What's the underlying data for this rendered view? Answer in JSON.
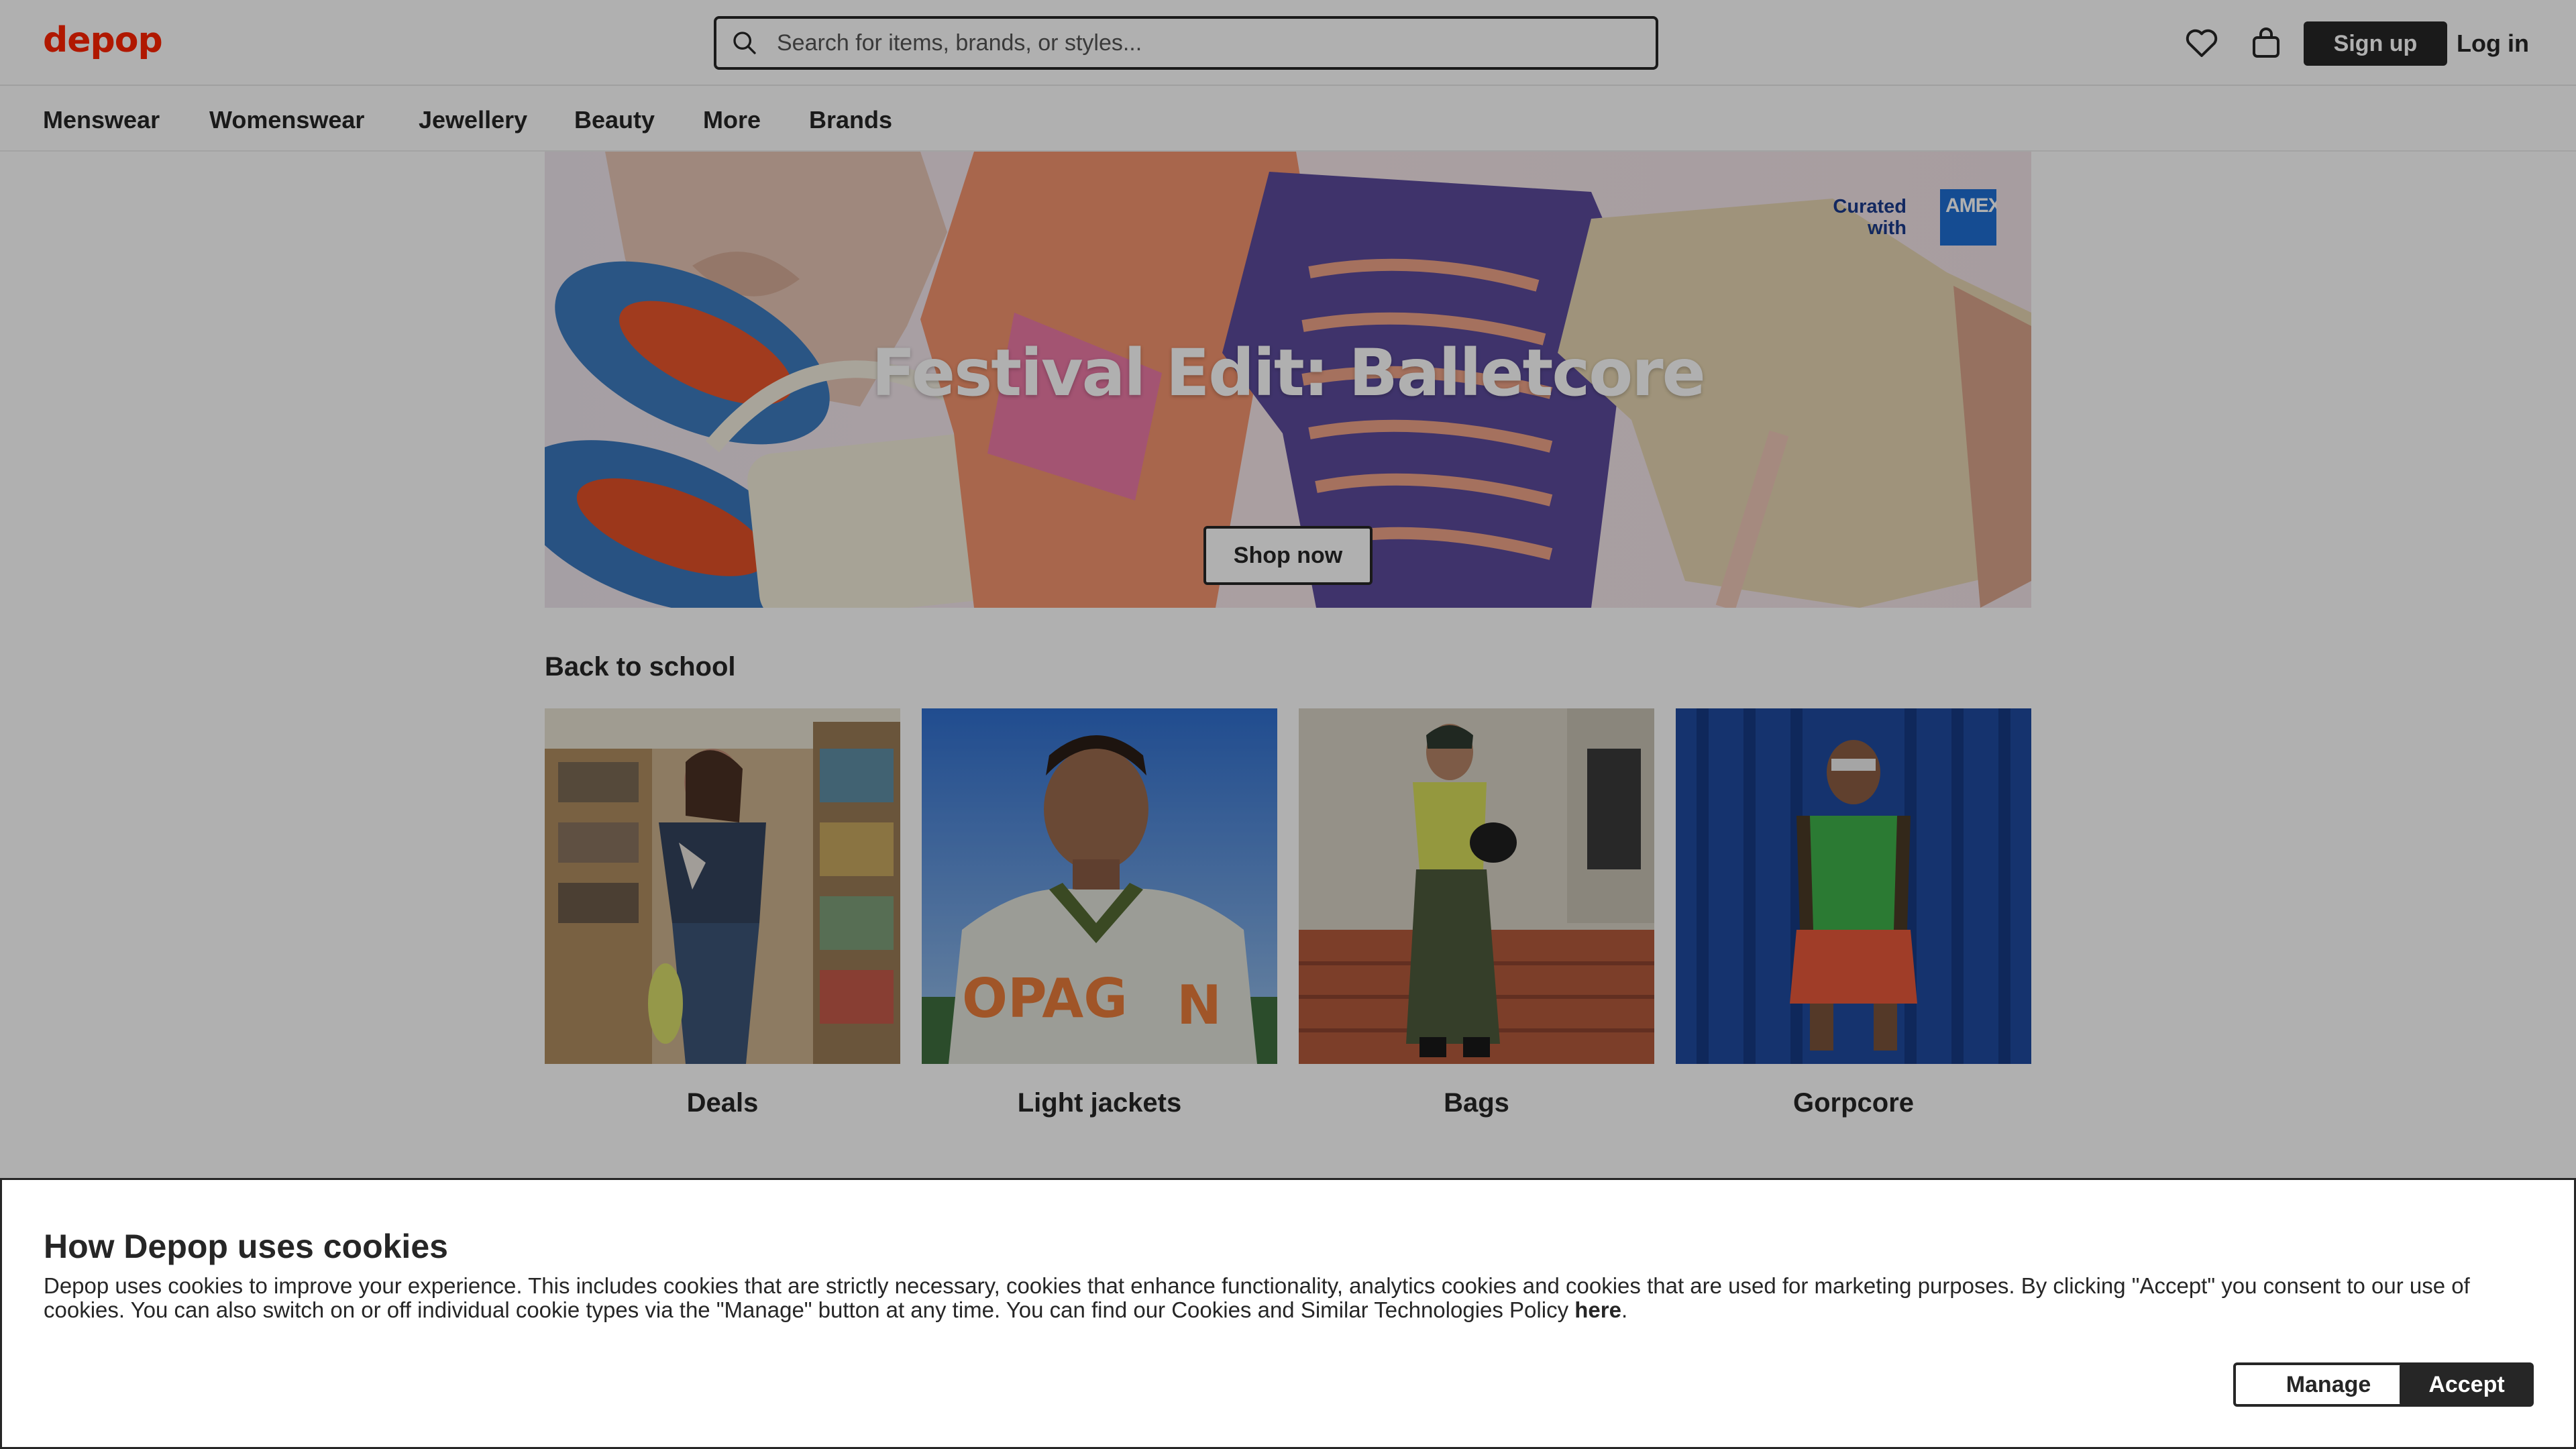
{
  "header": {
    "logo": "depop",
    "search_placeholder": "Search for items, brands, or styles...",
    "signup_label": "Sign up",
    "login_label": "Log in",
    "icons": [
      "search-icon",
      "heart-icon",
      "bag-icon"
    ]
  },
  "nav": {
    "items": [
      "Menswear",
      "Womenswear",
      "Jewellery",
      "Beauty",
      "More",
      "Brands"
    ]
  },
  "hero": {
    "title": "Festival Edit: Balletcore",
    "button": "Shop now",
    "curated_line1": "Curated",
    "curated_line2": "with",
    "partner_logo_text": "AMEX"
  },
  "section": {
    "title": "Back to school",
    "tiles": [
      "Deals",
      "Light jackets",
      "Bags",
      "Gorpcore"
    ]
  },
  "cookies": {
    "title": "How Depop uses cookies",
    "body": "Depop uses cookies to improve your experience. This includes cookies that are strictly necessary, cookies that enhance functionality, analytics cookies and cookies that are used for marketing purposes. By clicking \"Accept\" you consent to our use of cookies. You can also switch on or off individual cookie types via the \"Manage\" button at any time. You can find our Cookies and Similar Technologies Policy",
    "link": "here",
    "manage_label": "Manage",
    "accept_label": "Accept"
  },
  "colors": {
    "brand": "#ff2300",
    "ink": "#262626",
    "overlay": "rgba(0,0,0,0.31)"
  }
}
